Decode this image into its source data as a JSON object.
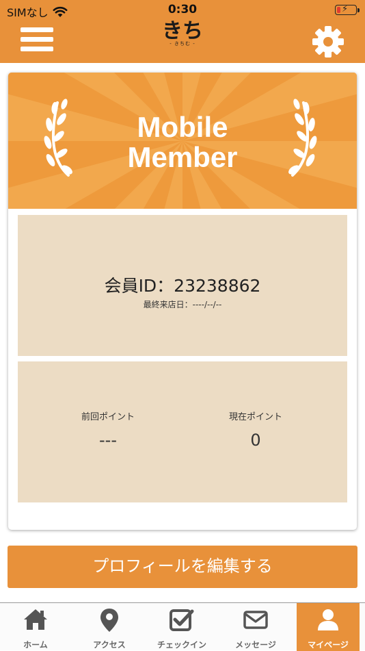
{
  "status_bar": {
    "carrier": "SIMなし",
    "time": "0:30"
  },
  "header": {
    "logo_text": "きち",
    "logo_subtext": "- きちむ -",
    "menu_icon": "hamburger-menu-icon",
    "settings_icon": "gear-icon"
  },
  "card": {
    "banner_line1": "Mobile",
    "banner_line2": "Member",
    "member_id": "会員ID：23238862",
    "last_visit": "最終来店日：----/--/--",
    "points": {
      "previous_label": "前回ポイント",
      "previous_value": "---",
      "current_label": "現在ポイント",
      "current_value": "0"
    }
  },
  "edit_profile_label": "プロフィールを編集する",
  "tabs": [
    {
      "label": "ホーム",
      "icon": "home-icon",
      "active": false
    },
    {
      "label": "アクセス",
      "icon": "map-pin-icon",
      "active": false
    },
    {
      "label": "チェックイン",
      "icon": "checkbox-icon",
      "active": false
    },
    {
      "label": "メッセージ",
      "icon": "envelope-icon",
      "active": false
    },
    {
      "label": "マイページ",
      "icon": "user-icon",
      "active": true
    }
  ],
  "colors": {
    "accent": "#e8913a",
    "banner": "#ee9a3c",
    "panel": "#ecdcc4",
    "tab_inactive": "#666666",
    "battery_low": "#e23c2e"
  }
}
